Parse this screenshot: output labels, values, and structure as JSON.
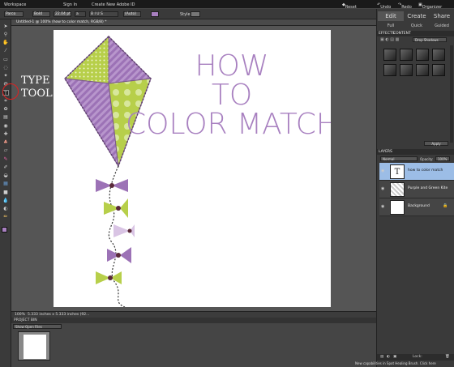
{
  "topbar": {
    "workspace_menu": "Workspace",
    "sign_in": "Sign In",
    "create_id": "Create New Adobe ID",
    "reset_panels": "Reset Panels",
    "undo": "Undo",
    "redo": "Redo",
    "organizer": "Organizer"
  },
  "options": {
    "font": "Parco",
    "style": "Bold",
    "size": "22.04 pt",
    "leading": "(Auto)",
    "style_label": "Style:"
  },
  "document": {
    "tab_title": "Untitled-1 @ 100% (how to color match, RGB/8) *",
    "zoom": "100%",
    "size_info": "5.333 inches x 5.333 inches (92..."
  },
  "annotation": {
    "line1": "TYPE",
    "line2": "TOOL"
  },
  "artwork": {
    "heading_line1": "HOW",
    "heading_line2": "TO",
    "heading_line3": "COLOR MATCH",
    "purple": "#a880c0",
    "green": "#b7cf4a"
  },
  "project_bin": {
    "title": "PROJECT BIN",
    "dropdown": "Show Open Files"
  },
  "right_panel": {
    "tabs": [
      "Edit",
      "Create",
      "Share"
    ],
    "subtabs": [
      "Full",
      "Quick",
      "Guided"
    ],
    "effects_title": "EFFECTS",
    "content_title": "CONTENT",
    "effects_dropdown": "Drop Shadows",
    "apply": "Apply",
    "layers_title": "LAYERS",
    "blend_mode": "Normal",
    "opacity_label": "Opacity:",
    "opacity_value": "100%",
    "layers": [
      {
        "name": "how to color match",
        "selected": true
      },
      {
        "name": "Purple and Green Kite",
        "selected": false
      },
      {
        "name": "Background",
        "selected": false
      }
    ],
    "lock_label": "Lock:"
  },
  "status_bottom": "New capabilities in Spot Healing Brush. Click here"
}
